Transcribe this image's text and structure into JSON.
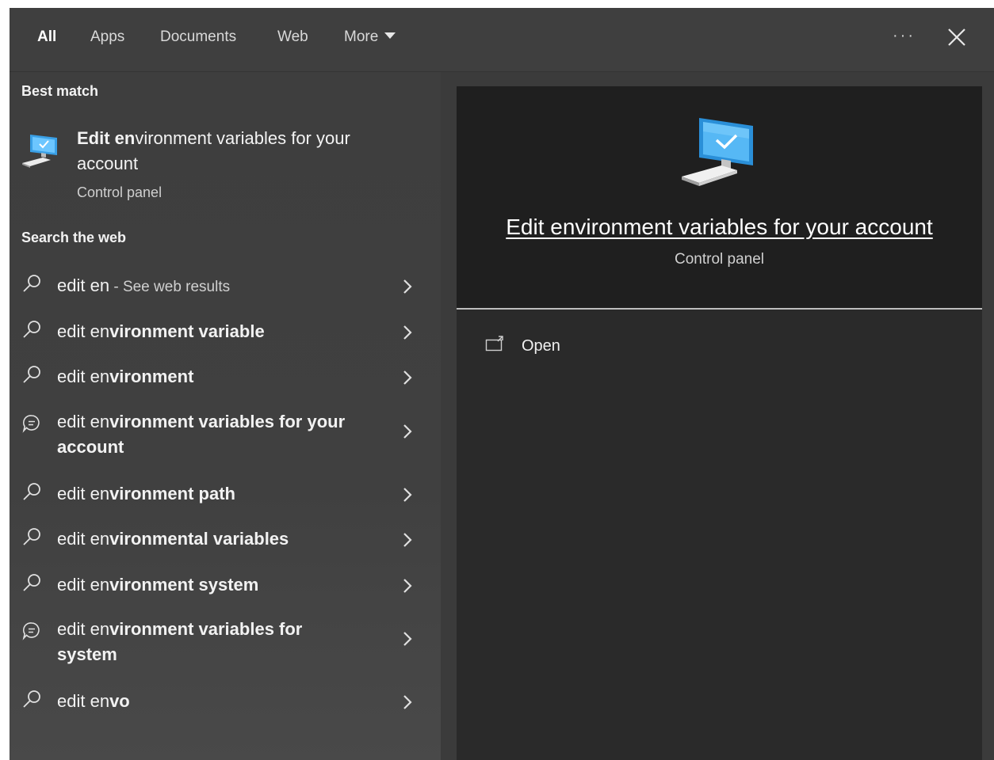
{
  "tabs": [
    {
      "label": "All",
      "active": true
    },
    {
      "label": "Apps",
      "active": false
    },
    {
      "label": "Documents",
      "active": false
    },
    {
      "label": "Web",
      "active": false
    },
    {
      "label": "More",
      "active": false
    }
  ],
  "header": {
    "ellipsis": "···"
  },
  "best_match": {
    "section_title": "Best match",
    "title_bold": "Edit en",
    "title_rest": "vironment variables for your account",
    "subtitle": "Control panel"
  },
  "web": {
    "section_title": "Search the web",
    "items": [
      {
        "icon": "search-icon",
        "prefix": "edit en",
        "suffix": "",
        "hint": " - See web results"
      },
      {
        "icon": "search-icon",
        "prefix": "edit en",
        "suffix": "vironment variable",
        "hint": ""
      },
      {
        "icon": "search-icon",
        "prefix": "edit en",
        "suffix": "vironment",
        "hint": ""
      },
      {
        "icon": "chat-icon",
        "prefix": "edit en",
        "suffix": "vironment variables for your account",
        "hint": ""
      },
      {
        "icon": "search-icon",
        "prefix": "edit en",
        "suffix": "vironment path",
        "hint": ""
      },
      {
        "icon": "search-icon",
        "prefix": "edit en",
        "suffix": "vironmental variables",
        "hint": ""
      },
      {
        "icon": "search-icon",
        "prefix": "edit en",
        "suffix": "vironment system",
        "hint": ""
      },
      {
        "icon": "chat-icon",
        "prefix": "edit en",
        "suffix": "vironment variables for system",
        "hint": ""
      },
      {
        "icon": "search-icon",
        "prefix": "edit en",
        "suffix": "vo",
        "hint": ""
      }
    ]
  },
  "preview": {
    "title": "Edit environment variables for your account",
    "subtitle": "Control panel",
    "actions": [
      {
        "icon": "open-window-icon",
        "label": "Open"
      }
    ]
  },
  "colors": {
    "accent_blue": "#2ea3f2",
    "pane_bg": "#3e3e3e",
    "preview_bg": "#1f1f1f"
  }
}
